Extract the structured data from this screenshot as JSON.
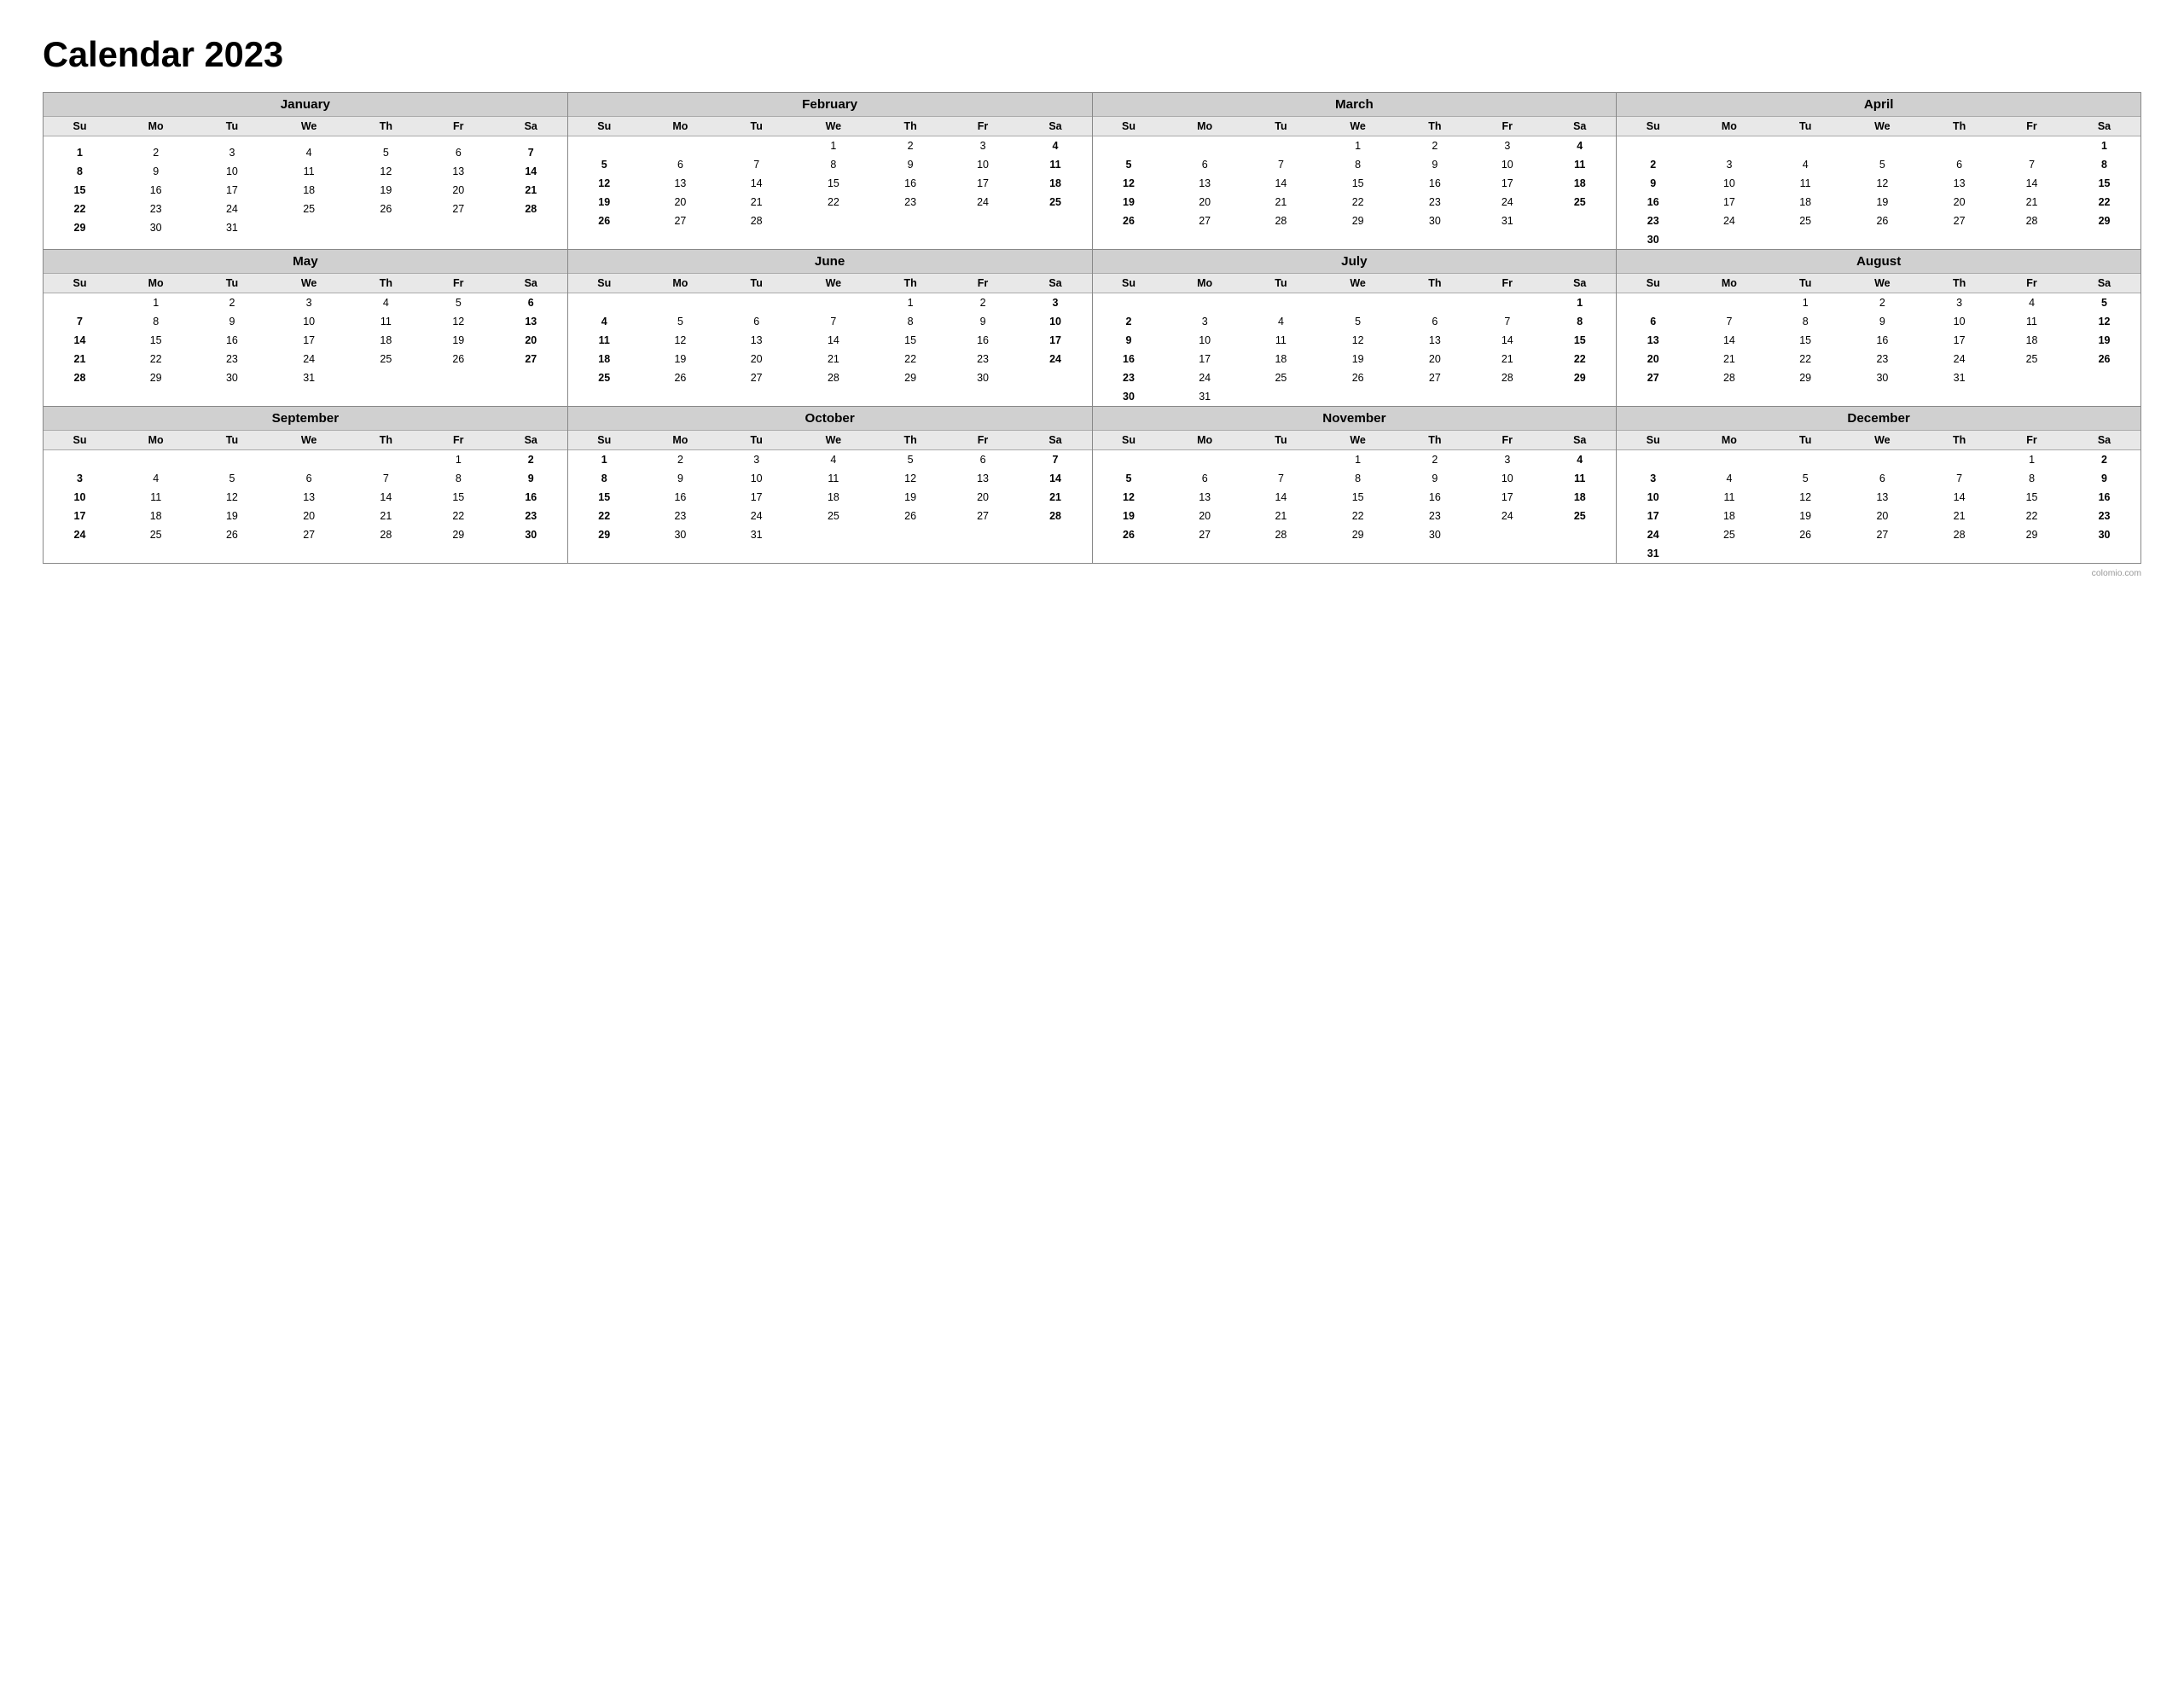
{
  "title": "Calendar 2023",
  "months": [
    {
      "name": "January",
      "days": [
        [
          "",
          "",
          "",
          "",
          "",
          "",
          ""
        ],
        [
          "1",
          "2",
          "3",
          "4",
          "5",
          "6",
          "7"
        ],
        [
          "8",
          "9",
          "10",
          "11",
          "12",
          "13",
          "14"
        ],
        [
          "15",
          "16",
          "17",
          "18",
          "19",
          "20",
          "21"
        ],
        [
          "22",
          "23",
          "24",
          "25",
          "26",
          "27",
          "28"
        ],
        [
          "29",
          "30",
          "31",
          "",
          "",
          "",
          ""
        ]
      ]
    },
    {
      "name": "February",
      "days": [
        [
          "",
          "",
          "",
          "1",
          "2",
          "3",
          "4"
        ],
        [
          "5",
          "6",
          "7",
          "8",
          "9",
          "10",
          "11"
        ],
        [
          "12",
          "13",
          "14",
          "15",
          "16",
          "17",
          "18"
        ],
        [
          "19",
          "20",
          "21",
          "22",
          "23",
          "24",
          "25"
        ],
        [
          "26",
          "27",
          "28",
          "",
          "",
          "",
          ""
        ]
      ]
    },
    {
      "name": "March",
      "days": [
        [
          "",
          "",
          "",
          "1",
          "2",
          "3",
          "4"
        ],
        [
          "5",
          "6",
          "7",
          "8",
          "9",
          "10",
          "11"
        ],
        [
          "12",
          "13",
          "14",
          "15",
          "16",
          "17",
          "18"
        ],
        [
          "19",
          "20",
          "21",
          "22",
          "23",
          "24",
          "25"
        ],
        [
          "26",
          "27",
          "28",
          "29",
          "30",
          "31",
          ""
        ]
      ]
    },
    {
      "name": "April",
      "days": [
        [
          "",
          "",
          "",
          "",
          "",
          "",
          "1"
        ],
        [
          "2",
          "3",
          "4",
          "5",
          "6",
          "7",
          "8"
        ],
        [
          "9",
          "10",
          "11",
          "12",
          "13",
          "14",
          "15"
        ],
        [
          "16",
          "17",
          "18",
          "19",
          "20",
          "21",
          "22"
        ],
        [
          "23",
          "24",
          "25",
          "26",
          "27",
          "28",
          "29"
        ],
        [
          "30",
          "",
          "",
          "",
          "",
          "",
          ""
        ]
      ]
    },
    {
      "name": "May",
      "days": [
        [
          "",
          "1",
          "2",
          "3",
          "4",
          "5",
          "6"
        ],
        [
          "7",
          "8",
          "9",
          "10",
          "11",
          "12",
          "13"
        ],
        [
          "14",
          "15",
          "16",
          "17",
          "18",
          "19",
          "20"
        ],
        [
          "21",
          "22",
          "23",
          "24",
          "25",
          "26",
          "27"
        ],
        [
          "28",
          "29",
          "30",
          "31",
          "",
          "",
          ""
        ]
      ]
    },
    {
      "name": "June",
      "days": [
        [
          "",
          "",
          "",
          "",
          "1",
          "2",
          "3"
        ],
        [
          "4",
          "5",
          "6",
          "7",
          "8",
          "9",
          "10"
        ],
        [
          "11",
          "12",
          "13",
          "14",
          "15",
          "16",
          "17"
        ],
        [
          "18",
          "19",
          "20",
          "21",
          "22",
          "23",
          "24"
        ],
        [
          "25",
          "26",
          "27",
          "28",
          "29",
          "30",
          ""
        ]
      ]
    },
    {
      "name": "July",
      "days": [
        [
          "",
          "",
          "",
          "",
          "",
          "",
          "1"
        ],
        [
          "2",
          "3",
          "4",
          "5",
          "6",
          "7",
          "8"
        ],
        [
          "9",
          "10",
          "11",
          "12",
          "13",
          "14",
          "15"
        ],
        [
          "16",
          "17",
          "18",
          "19",
          "20",
          "21",
          "22"
        ],
        [
          "23",
          "24",
          "25",
          "26",
          "27",
          "28",
          "29"
        ],
        [
          "30",
          "31",
          "",
          "",
          "",
          "",
          ""
        ]
      ]
    },
    {
      "name": "August",
      "days": [
        [
          "",
          "",
          "1",
          "2",
          "3",
          "4",
          "5"
        ],
        [
          "6",
          "7",
          "8",
          "9",
          "10",
          "11",
          "12"
        ],
        [
          "13",
          "14",
          "15",
          "16",
          "17",
          "18",
          "19"
        ],
        [
          "20",
          "21",
          "22",
          "23",
          "24",
          "25",
          "26"
        ],
        [
          "27",
          "28",
          "29",
          "30",
          "31",
          "",
          ""
        ]
      ]
    },
    {
      "name": "September",
      "days": [
        [
          "",
          "",
          "",
          "",
          "",
          "1",
          "2"
        ],
        [
          "3",
          "4",
          "5",
          "6",
          "7",
          "8",
          "9"
        ],
        [
          "10",
          "11",
          "12",
          "13",
          "14",
          "15",
          "16"
        ],
        [
          "17",
          "18",
          "19",
          "20",
          "21",
          "22",
          "23"
        ],
        [
          "24",
          "25",
          "26",
          "27",
          "28",
          "29",
          "30"
        ]
      ]
    },
    {
      "name": "October",
      "days": [
        [
          "1",
          "2",
          "3",
          "4",
          "5",
          "6",
          "7"
        ],
        [
          "8",
          "9",
          "10",
          "11",
          "12",
          "13",
          "14"
        ],
        [
          "15",
          "16",
          "17",
          "18",
          "19",
          "20",
          "21"
        ],
        [
          "22",
          "23",
          "24",
          "25",
          "26",
          "27",
          "28"
        ],
        [
          "29",
          "30",
          "31",
          "",
          "",
          "",
          ""
        ]
      ]
    },
    {
      "name": "November",
      "days": [
        [
          "",
          "",
          "",
          "1",
          "2",
          "3",
          "4"
        ],
        [
          "5",
          "6",
          "7",
          "8",
          "9",
          "10",
          "11"
        ],
        [
          "12",
          "13",
          "14",
          "15",
          "16",
          "17",
          "18"
        ],
        [
          "19",
          "20",
          "21",
          "22",
          "23",
          "24",
          "25"
        ],
        [
          "26",
          "27",
          "28",
          "29",
          "30",
          "",
          ""
        ]
      ]
    },
    {
      "name": "December",
      "days": [
        [
          "",
          "",
          "",
          "",
          "",
          "1",
          "2"
        ],
        [
          "3",
          "4",
          "5",
          "6",
          "7",
          "8",
          "9"
        ],
        [
          "10",
          "11",
          "12",
          "13",
          "14",
          "15",
          "16"
        ],
        [
          "17",
          "18",
          "19",
          "20",
          "21",
          "22",
          "23"
        ],
        [
          "24",
          "25",
          "26",
          "27",
          "28",
          "29",
          "30"
        ],
        [
          "31",
          "",
          "",
          "",
          "",
          "",
          ""
        ]
      ]
    }
  ],
  "weekdays": [
    "Su",
    "Mo",
    "Tu",
    "We",
    "Th",
    "Fr",
    "Sa"
  ],
  "footer": "colomio.com"
}
